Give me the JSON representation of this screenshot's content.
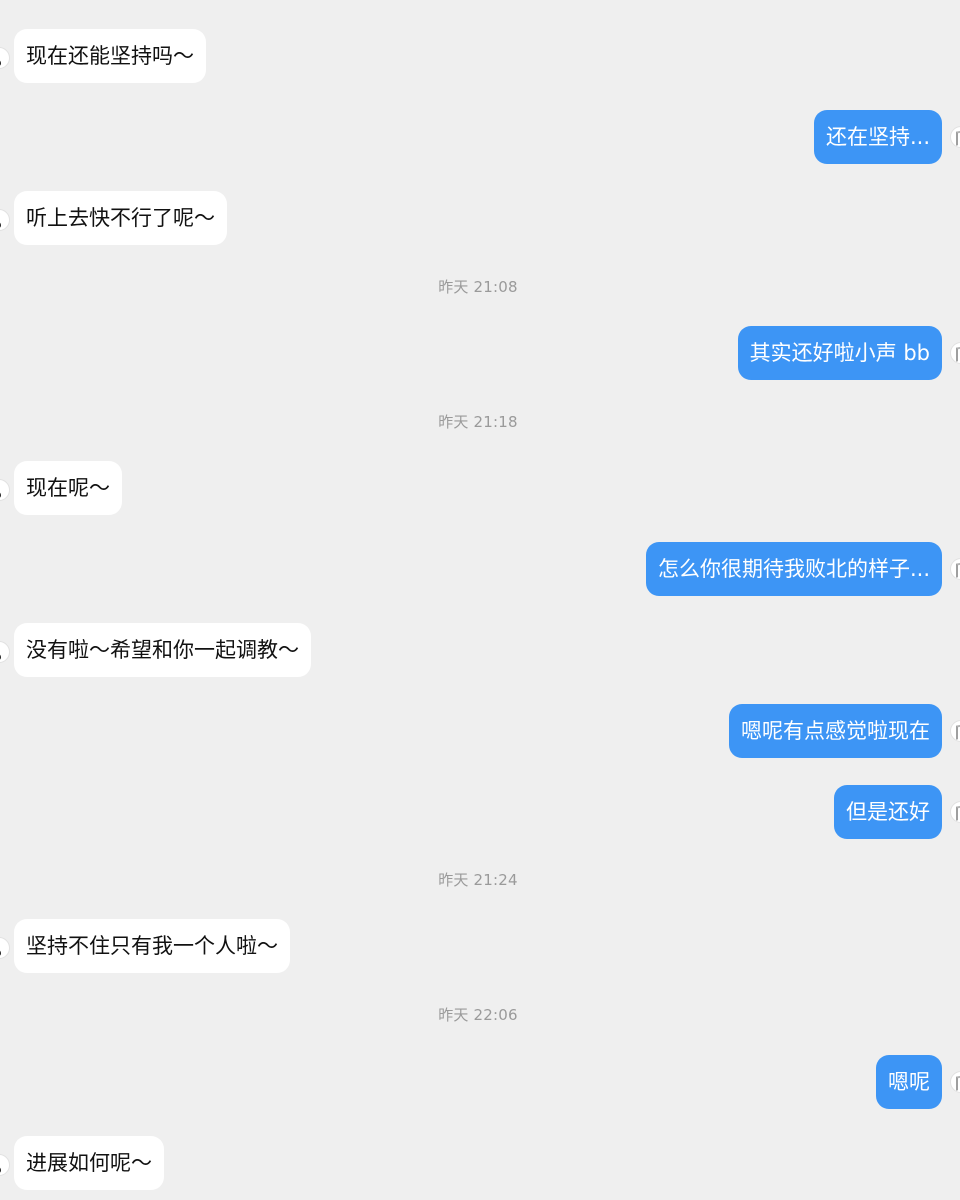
{
  "chat": {
    "messages": [
      {
        "side": "in",
        "text": "现在还能坚持吗～"
      },
      {
        "side": "out",
        "text": "还在坚持..."
      },
      {
        "side": "in",
        "text": "听上去快不行了呢～"
      },
      {
        "side": "time",
        "text": "昨天 21:08"
      },
      {
        "side": "out",
        "text": "其实还好啦小声 bb"
      },
      {
        "side": "time",
        "text": "昨天 21:18"
      },
      {
        "side": "in",
        "text": "现在呢～"
      },
      {
        "side": "out",
        "text": "怎么你很期待我败北的样子..."
      },
      {
        "side": "in",
        "text": "没有啦～希望和你一起调教～"
      },
      {
        "side": "out",
        "text": "嗯呢有点感觉啦现在"
      },
      {
        "side": "out",
        "text": "但是还好"
      },
      {
        "side": "time",
        "text": "昨天 21:24"
      },
      {
        "side": "in",
        "text": "坚持不住只有我一个人啦～"
      },
      {
        "side": "time",
        "text": "昨天 22:06"
      },
      {
        "side": "out",
        "text": "嗯呢"
      },
      {
        "side": "in",
        "text": "进展如何呢～"
      }
    ]
  },
  "colors": {
    "background": "#efefef",
    "incoming_bubble": "#ffffff",
    "outgoing_bubble": "#3d95f5",
    "timestamp_text": "#9a9a9a"
  }
}
